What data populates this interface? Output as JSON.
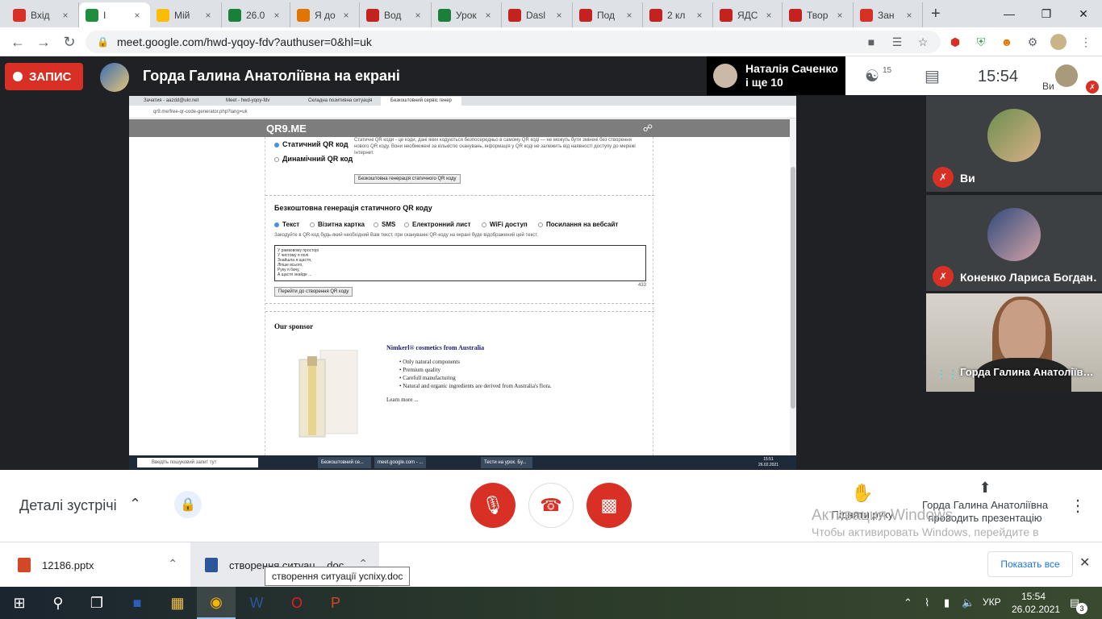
{
  "browser": {
    "tabs": [
      {
        "title": "Вхід",
        "color": "#d93025"
      },
      {
        "title": "I",
        "color": "#1e8e3e",
        "active": true
      },
      {
        "title": "Мій",
        "color": "#fbbc04"
      },
      {
        "title": "26.0",
        "color": "#188038"
      },
      {
        "title": "Я до",
        "color": "#e37400"
      },
      {
        "title": "Вод",
        "color": "#c5221f"
      },
      {
        "title": "Урок",
        "color": "#188038"
      },
      {
        "title": "Dasl",
        "color": "#c5221f"
      },
      {
        "title": "Под",
        "color": "#c5221f"
      },
      {
        "title": "2 кл",
        "color": "#c5221f"
      },
      {
        "title": "ЯДС",
        "color": "#c5221f"
      },
      {
        "title": "Твор",
        "color": "#c5221f"
      },
      {
        "title": "Зан",
        "color": "#d93025"
      }
    ],
    "new_tab": "+",
    "url": "meet.google.com/hwd-yqoy-fdv?authuser=0&hl=uk"
  },
  "meet": {
    "record_label": "ЗАПИС",
    "presenting_label": "Горда Галина Анатоліївна на екрані",
    "pinned_name_line1": "Наталія Саченко",
    "pinned_name_line2": "і ще 10",
    "participants_count": "15",
    "time": "15:54",
    "self_label": "Ви",
    "participants": [
      {
        "name": "Ви",
        "muted": true
      },
      {
        "name": "Коненко Лариса Богдан…",
        "muted": true
      },
      {
        "name": "Горда Галина Анатоліїв…",
        "muted": false
      }
    ],
    "details_label": "Деталі зустрічі",
    "raise_hand_label": "Підняти руку",
    "present_label_line1": "Горда Галина Анатоліївна",
    "present_label_line2": "проводить презентацію",
    "activation_line1": "Активация Windows",
    "activation_line2": "Чтобы активировать Windows, перейдите в раздел \"Параметры\"."
  },
  "shared_screen": {
    "tabs": [
      "Зачатия - aazdd@ukr.net",
      "Meet - hwd-yqoy-fdv",
      "Складна позитивна ситуація",
      "Безкоштовний сервіс генер"
    ],
    "address": "qr9.me/free-qr-code-generator.php?lang=uk",
    "logo": "QR9.ME",
    "static_label": "Статичний QR код",
    "dynamic_label": "Динамічний QR код",
    "static_desc": "Статичні QR коди - це коди, дані яких кодуються безпосередньо в самому QR коді — не можуть бути змінені без створення нового QR коду. Вони необмежені за кількістю сканувань, інформація у QR коді не залежить від наявності доступу до мережі Інтернет.",
    "free_btn": "Безкоштовна генерація статичного QR коду",
    "section_title": "Безкоштовна генерація статичного QR коду",
    "types": [
      "Текст",
      "Візитна картка",
      "SMS",
      "Електронний лист",
      "WiFi доступ",
      "Посилання на вебсайт"
    ],
    "type_hint": "Закодуйте в QR-код будь-який необхідний Вам текст, при скануванні QR-коду на екрані буде відображений цей текст.",
    "textarea": "У рамковому просторі\nУ чистому я полі\nЗнайшла я щастя,\nЛіпше всього,\nРуку я бачу,\nА щастя знайде ...",
    "char_count": "433",
    "generate_btn": "Перейти до створення QR коду",
    "sponsor_heading": "Our sponsor",
    "sponsor_title": "Nimkerl® cosmetics from Australia",
    "sponsor_items": [
      "Only natural components",
      "Premium quality",
      "Carefull manufacturing",
      "Natural and organic ingredients are derived from Australia's flora."
    ],
    "sponsor_link": "Learn more ...",
    "taskbar_search": "Введіть пошуковий запит тут",
    "taskbar_apps": [
      "Безкоштовний се...",
      "meet.google.com - ...",
      "Тести на урок. Бу..."
    ],
    "taskbar_time": "15:51",
    "taskbar_date": "26.02.2021"
  },
  "downloads": [
    {
      "name": "12186.pptx"
    },
    {
      "name": "створення ситуац....doc"
    }
  ],
  "download_tooltip": "створення ситуації успіху.doc",
  "show_all_label": "Показать все",
  "windows": {
    "lang": "УКР",
    "time": "15:54",
    "date": "26.02.2021",
    "notifications": "3"
  }
}
